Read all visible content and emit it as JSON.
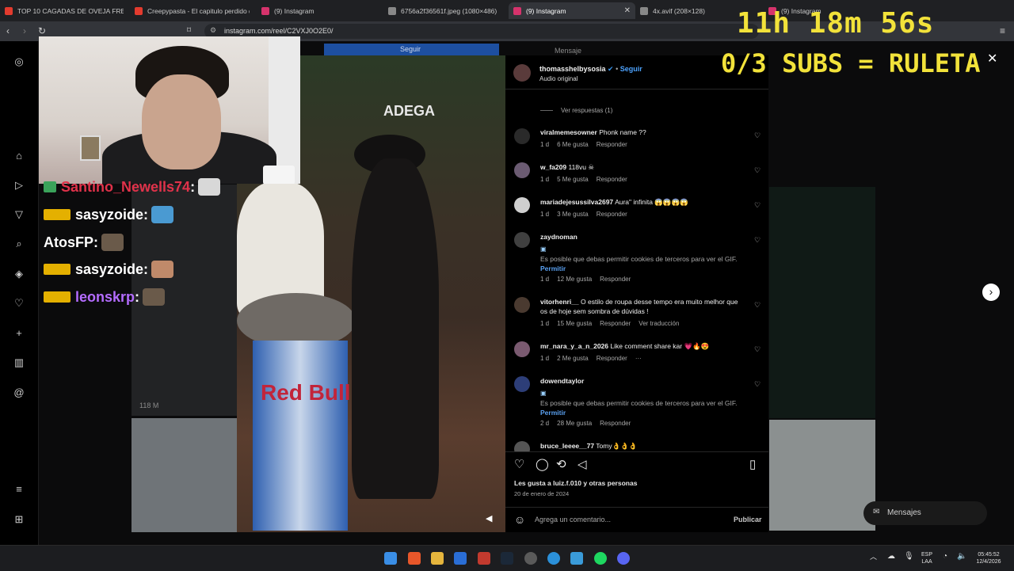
{
  "browser": {
    "tabs": [
      {
        "label": "TOP 10 CAGADAS DE OVEJA FREE F",
        "favicon_color": "#e33b2e"
      },
      {
        "label": "Creepypasta - El capitulo perdido d",
        "favicon_color": "#e33b2e"
      },
      {
        "label": "(9) Instagram",
        "favicon_color": "#d6336c"
      },
      {
        "label": "6756a2f36561f.jpeg (1080×486)",
        "favicon_color": "#888888"
      },
      {
        "label": "(9) Instagram",
        "favicon_color": "#d6336c",
        "active": true
      },
      {
        "label": "4x.avif (208×128)",
        "favicon_color": "#888888"
      },
      {
        "label": "(9) Instagram",
        "favicon_color": "#d6336c"
      }
    ],
    "url": "instagram.com/reel/C2VXJ0O2E0/"
  },
  "stream": {
    "timer": "11h 18m 56s",
    "subs_banner": "0/3 SUBS = RULETA",
    "chat": [
      {
        "user": "Santino_Newells74",
        "color": "#e0324a",
        "badge": "money"
      },
      {
        "user": "sasyzoide",
        "color": "#ffffff",
        "badge": "crown"
      },
      {
        "user": "AtosFP",
        "color": "#ffffff",
        "badge": ""
      },
      {
        "user": "sasyzoide",
        "color": "#ffffff",
        "badge": "crown"
      },
      {
        "user": "leonskrp",
        "color": "#b46cff",
        "badge": "crown"
      }
    ]
  },
  "video": {
    "overlay_follow": "Seguir",
    "overlay_message": "Mensaje",
    "sign": "ADEGA",
    "can_text": "Red Bull",
    "views": "118 M"
  },
  "post": {
    "author": "thomasshelbysosia",
    "follow": "Seguir",
    "audio": "Audio original",
    "view_replies": "Ver respuestas (1)",
    "likes_text": "Les gusta a luiz.f.010 y otras personas",
    "date": "20 de enero de 2024",
    "comment_placeholder": "Agrega un comentario...",
    "publish": "Publicar",
    "gif_notice": "Es posible que debas permitir cookies de terceros para ver el GIF.",
    "permit": "Permitir",
    "reply": "Responder",
    "translate": "Ver traducción",
    "comments": [
      {
        "user": "viralmemesowner",
        "text": "Phonk name ??",
        "age": "1 d",
        "likes": "6 Me gusta"
      },
      {
        "user": "w_fa209",
        "text": "118vu ☠",
        "age": "1 d",
        "likes": "5 Me gusta"
      },
      {
        "user": "mariadejesussilva2697",
        "text": "Aura\" infinita 😱😱😱😱",
        "age": "1 d",
        "likes": "3 Me gusta"
      },
      {
        "user": "zaydnoman",
        "text": "",
        "age": "1 d",
        "likes": "12 Me gusta",
        "gif": true
      },
      {
        "user": "vitorhenri__",
        "text": "O estilo de roupa desse tempo era muito melhor que os de hoje sem sombra de dúvidas !",
        "age": "1 d",
        "likes": "15 Me gusta",
        "translate": true
      },
      {
        "user": "mr_nara_y_a_n_2026",
        "text": "Like comment share kar 💗🔥😍",
        "age": "1 d",
        "likes": "2 Me gusta"
      },
      {
        "user": "dowendtaylor",
        "text": "",
        "age": "2 d",
        "likes": "28 Me gusta",
        "gif": true
      },
      {
        "user": "bruce_leeee__77",
        "text": "Tomy👌👌👌",
        "age": "",
        "likes": ""
      }
    ]
  },
  "sidebar": {
    "icons": [
      "instagram-icon",
      "home-icon",
      "reels-icon",
      "explore-icon",
      "search-icon",
      "compass-icon",
      "heart-icon",
      "create-icon",
      "dashboard-icon",
      "threads-icon",
      "menu-icon",
      "apps-icon"
    ]
  },
  "floating": {
    "messages": "Mensajes"
  },
  "taskbar": {
    "lang": "ESP",
    "lang2": "LAA",
    "time": "05:45:52",
    "date": "12/4/2026"
  }
}
